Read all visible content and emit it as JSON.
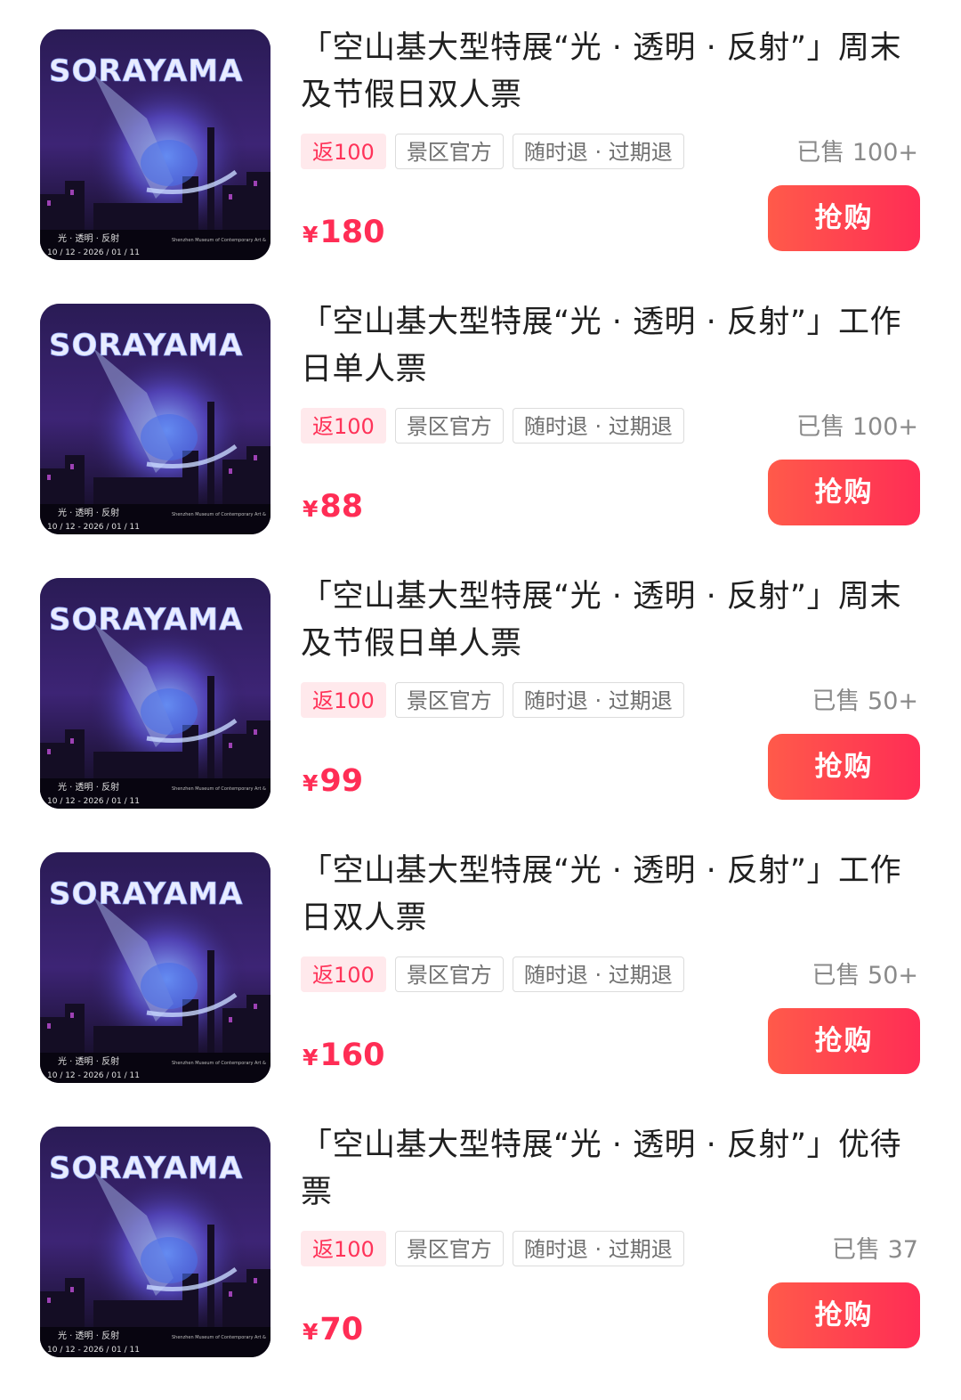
{
  "colors": {
    "accent": "#ff2d55",
    "tag_bg": "#ffe9ec",
    "muted": "#8a8a8a"
  },
  "poster": {
    "logo": "SORAYAMA",
    "subtitle": "光 · 透明 · 反射",
    "dates": "10 / 12 - 2026 / 01 / 11",
    "museum": "Shenzhen Museum of Contemporary Art &"
  },
  "products": [
    {
      "title": "「空山基大型特展“光 · 透明 · 反射”」周末及节假日双人票",
      "tags": [
        "返100",
        "景区官方",
        "随时退 · 过期退"
      ],
      "sold": "已售 100+",
      "currency": "¥",
      "price": "180",
      "buy": "抢购"
    },
    {
      "title": "「空山基大型特展“光 · 透明 · 反射”」工作日单人票",
      "tags": [
        "返100",
        "景区官方",
        "随时退 · 过期退"
      ],
      "sold": "已售 100+",
      "currency": "¥",
      "price": "88",
      "buy": "抢购"
    },
    {
      "title": "「空山基大型特展“光 · 透明 · 反射”」周末及节假日单人票",
      "tags": [
        "返100",
        "景区官方",
        "随时退 · 过期退"
      ],
      "sold": "已售 50+",
      "currency": "¥",
      "price": "99",
      "buy": "抢购"
    },
    {
      "title": "「空山基大型特展“光 · 透明 · 反射”」工作日双人票",
      "tags": [
        "返100",
        "景区官方",
        "随时退 · 过期退"
      ],
      "sold": "已售 50+",
      "currency": "¥",
      "price": "160",
      "buy": "抢购"
    },
    {
      "title": "「空山基大型特展“光 · 透明 · 反射”」优待票",
      "tags": [
        "返100",
        "景区官方",
        "随时退 · 过期退"
      ],
      "sold": "已售 37",
      "currency": "¥",
      "price": "70",
      "buy": "抢购"
    }
  ]
}
